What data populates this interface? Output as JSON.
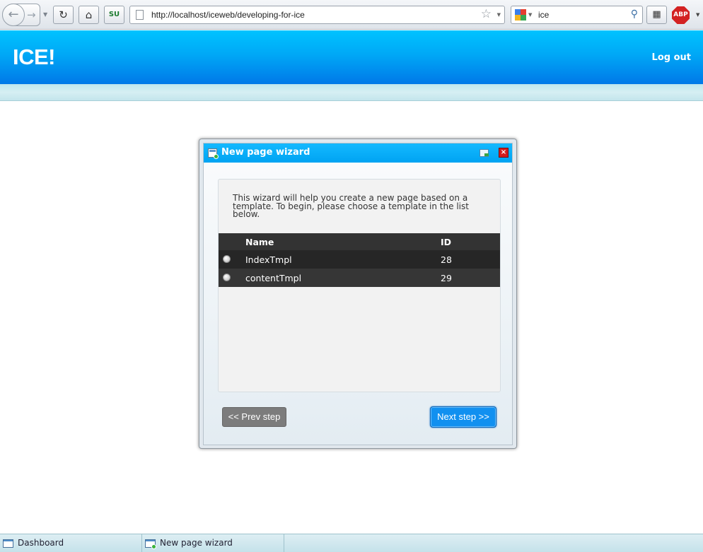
{
  "browser": {
    "url": "http://localhost/iceweb/developing-for-ice",
    "search_value": "ice",
    "extension_label": "ABP",
    "addon_label": "SU"
  },
  "header": {
    "logo": "ICE!",
    "logout_label": "Log out"
  },
  "wizard": {
    "title": "New page wizard",
    "intro": "This wizard will help you create a new page based on a template. To begin, please choose a template in the list below.",
    "table": {
      "columns": [
        "",
        "Name",
        "ID"
      ],
      "rows": [
        {
          "name": "IndexTmpl",
          "id": "28"
        },
        {
          "name": "contentTmpl",
          "id": "29"
        }
      ]
    },
    "prev_label": "<< Prev step",
    "next_label": "Next step >>"
  },
  "taskbar": {
    "items": [
      {
        "label": "Dashboard"
      },
      {
        "label": "New page wizard"
      }
    ]
  },
  "colors": {
    "header_blue": "#00a8f6",
    "accent_button": "#1190f0",
    "table_header": "#333333",
    "close_red": "#d51d1d"
  }
}
